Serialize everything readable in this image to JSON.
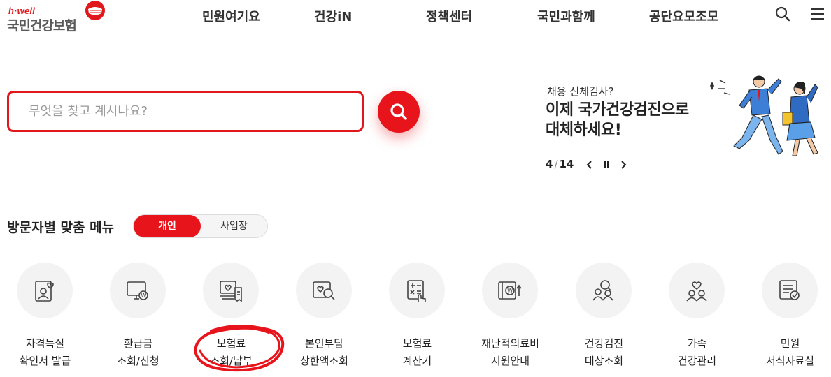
{
  "header": {
    "logo_small": "h·well",
    "logo_main": "국민건강보험",
    "nav": [
      "민원여기요",
      "건강iN",
      "정책센터",
      "국민과함께",
      "공단요모조모"
    ],
    "icons": [
      "search-icon",
      "hamburger-menu-icon"
    ]
  },
  "search": {
    "placeholder": "무엇을 찾고 계시나요?",
    "button_icon": "search-icon"
  },
  "banner": {
    "subtitle": "채용 신체검사?",
    "title_line1": "이제 국가건강검진으로",
    "title_line2": "대체하세요!",
    "current": "4",
    "separator": "/",
    "total": "14",
    "controls": [
      "chevron-left-icon",
      "pause-icon",
      "chevron-right-icon"
    ]
  },
  "visitor_menu": {
    "title": "방문자별 맞춤 메뉴",
    "tabs": [
      {
        "label": "개인",
        "active": true
      },
      {
        "label": "사업장",
        "active": false
      }
    ],
    "items": [
      {
        "line1": "자격득실",
        "line2": "확인서 발급",
        "icon": "certificate-icon"
      },
      {
        "line1": "환급금",
        "line2": "조회/신청",
        "icon": "refund-monitor-icon"
      },
      {
        "line1": "보험료",
        "line2": "조회/납부",
        "icon": "premium-receipt-icon"
      },
      {
        "line1": "본인부담",
        "line2": "상한액조회",
        "icon": "copay-search-icon"
      },
      {
        "line1": "보험료",
        "line2": "계산기",
        "icon": "calculator-icon"
      },
      {
        "line1": "재난적의료비",
        "line2": "지원안내",
        "icon": "medical-support-icon"
      },
      {
        "line1": "건강검진",
        "line2": "대상조회",
        "icon": "checkup-people-icon"
      },
      {
        "line1": "가족",
        "line2": "건강관리",
        "icon": "family-care-icon"
      },
      {
        "line1": "민원",
        "line2": "서식자료실",
        "icon": "forms-document-icon"
      }
    ]
  },
  "colors": {
    "brand_red": "#e8141c",
    "text_dark": "#222222",
    "icon_bg": "#f3f3f3"
  }
}
